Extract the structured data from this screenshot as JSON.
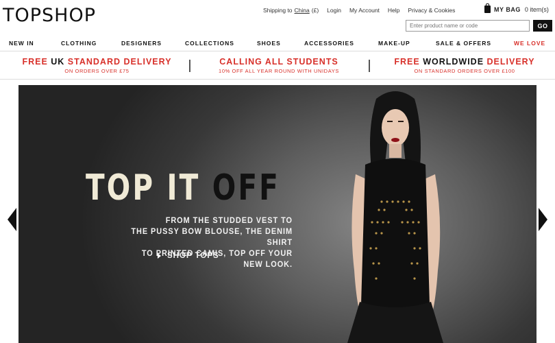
{
  "brand": {
    "logo_text": "TOPSHOP"
  },
  "utility": {
    "shipping_prefix": "Shipping to",
    "shipping_country": "China",
    "shipping_currency": "(£)",
    "login": "Login",
    "account": "My Account",
    "help": "Help",
    "privacy": "Privacy & Cookies"
  },
  "bag": {
    "label": "MY BAG",
    "count": "0 item(s)"
  },
  "search": {
    "placeholder": "Enter product name or code",
    "button": "GO"
  },
  "nav": {
    "items": [
      {
        "label": "NEW IN"
      },
      {
        "label": "CLOTHING"
      },
      {
        "label": "DESIGNERS"
      },
      {
        "label": "COLLECTIONS"
      },
      {
        "label": "SHOES"
      },
      {
        "label": "ACCESSORIES"
      },
      {
        "label": "MAKE-UP"
      },
      {
        "label": "SALE & OFFERS"
      },
      {
        "label": "WE LOVE"
      }
    ]
  },
  "promos": [
    {
      "title_a": "FREE ",
      "title_b": "UK ",
      "title_c": "STANDARD DELIVERY",
      "sub": "ON ORDERS OVER £75"
    },
    {
      "title_a": "CALLING ALL STUDENTS",
      "title_b": "",
      "title_c": "",
      "sub": "10% OFF ALL YEAR ROUND WITH UNIDAYS"
    },
    {
      "title_a": "FREE ",
      "title_b": "WORLDWIDE ",
      "title_c": "DELIVERY",
      "sub": "ON STANDARD ORDERS OVER £100"
    }
  ],
  "hero": {
    "title_light": "TOP IT ",
    "title_dark": "OFF",
    "copy_line1": "FROM THE STUDDED VEST TO",
    "copy_line2": "THE PUSSY BOW BLOUSE, THE DENIM SHIRT",
    "copy_line3": "TO PRINTED CAMIS, TOP OFF YOUR NEW LOOK.",
    "cta": "SHOP TOPS"
  },
  "colors": {
    "accent": "#d8302a",
    "text": "#111111",
    "hero_bg": "#3a3a3a",
    "title_cream": "#f0ead6"
  }
}
